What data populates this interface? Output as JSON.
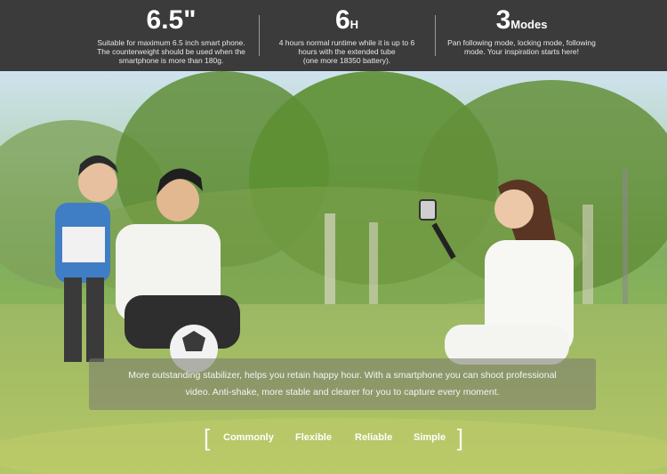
{
  "specs": [
    {
      "value": "6.5\"",
      "unit": "",
      "desc": [
        "Suitable for maximum 6.5 inch smart phone.",
        "The counterweight should be used when the",
        "smartphone is more than 180g."
      ]
    },
    {
      "value": "6",
      "unit": "H",
      "desc": [
        "4 hours normal runtime while it is up to 6",
        "hours with the extended tube",
        "(one more 18350 battery)."
      ]
    },
    {
      "value": "3",
      "unit": "Modes",
      "desc": [
        "Pan following mode, locking mode, following",
        "mode. Your inspiration starts here!"
      ]
    }
  ],
  "caption": {
    "line1": "More outstanding stabilizer, helps you retain happy hour.  With a smartphone you can shoot professional",
    "line2": "video. Anti-shake, more stable and clearer for you to capture every moment."
  },
  "tags": {
    "open_bracket": "[",
    "items": [
      "Commonly",
      "Flexible",
      "Reliable",
      "Simple"
    ],
    "close_bracket": "]"
  },
  "colors": {
    "topbar": "#3b3b3b",
    "text": "#ffffff"
  }
}
